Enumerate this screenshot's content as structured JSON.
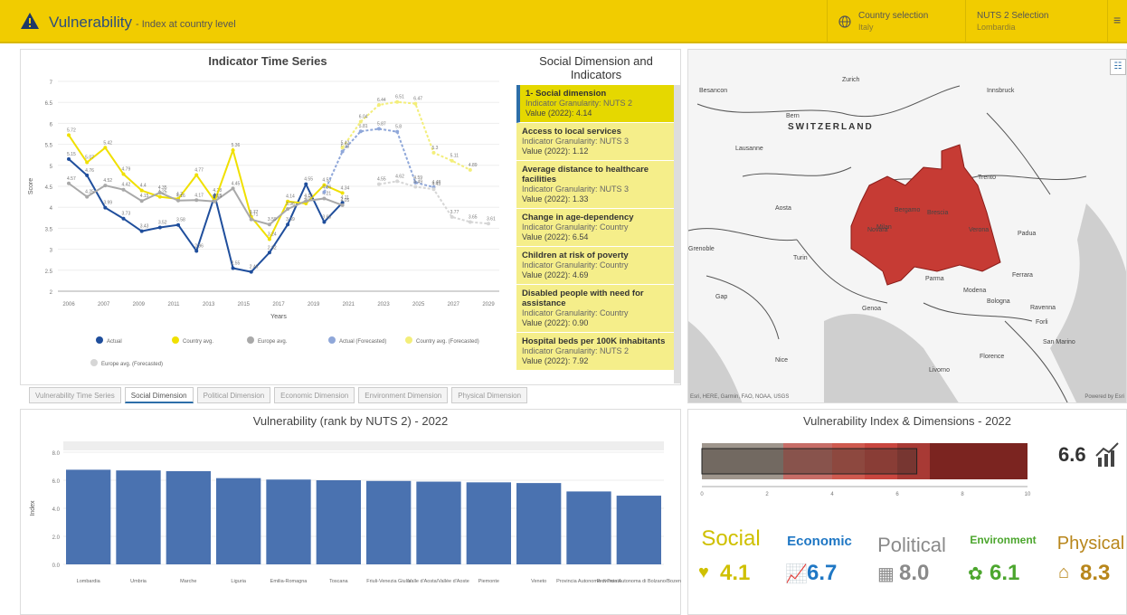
{
  "header": {
    "title": "Vulnerability",
    "subtitle": "- Index at country level",
    "country_label": "Country selection",
    "country_value": "Italy",
    "nuts_label": "NUTS 2 Selection",
    "nuts_value": "Lombardia"
  },
  "timeseries": {
    "title": "Indicator Time Series",
    "ylabel": "Score",
    "xlabel": "Years",
    "legend": [
      "Actual",
      "Country avg.",
      "Europe avg.",
      "Actual (Forecasted)",
      "Country avg. (Forecasted)",
      "Europe avg. (Forecasted)"
    ],
    "colors": {
      "actual": "#1f4e9c",
      "country": "#f0e000",
      "europe": "#a9a9a9",
      "actual_f": "#8fa7d9",
      "country_f": "#f3ee7a",
      "europe_f": "#d6d6d6"
    }
  },
  "chart_data": [
    {
      "type": "line",
      "title": "Indicator Time Series",
      "xlabel": "Years",
      "ylabel": "Score",
      "ylim": [
        2,
        7
      ],
      "x_ticks": [
        "2006",
        "2007",
        "2009",
        "2011",
        "2013",
        "2015",
        "2017",
        "2019",
        "2021",
        "2023",
        "2025",
        "2027",
        "2029"
      ],
      "y_ticks": [
        "2",
        "2.5",
        "3",
        "3.5",
        "4",
        "4.5",
        "5",
        "5.5",
        "6",
        "6.5",
        "7"
      ],
      "series": [
        {
          "name": "Actual",
          "values": [
            5.15,
            4.76,
            3.99,
            3.73,
            3.43,
            3.52,
            3.58,
            2.96,
            4.28,
            2.55,
            2.46,
            2.92,
            3.59,
            4.55,
            3.65,
            4.11
          ]
        },
        {
          "name": "Country avg.",
          "values": [
            5.72,
            5.07,
            5.42,
            4.79,
            4.4,
            4.25,
            4.2,
            4.77,
            4.15,
            5.36,
            3.77,
            3.24,
            4.14,
            4.09,
            4.53,
            4.34
          ]
        },
        {
          "name": "Europe avg.",
          "values": [
            4.57,
            4.25,
            4.52,
            4.42,
            4.15,
            4.35,
            4.16,
            4.17,
            4.14,
            4.45,
            3.71,
            3.59,
            3.96,
            4.15,
            4.21,
            4.05
          ]
        },
        {
          "name": "Actual (Forecasted)",
          "values": [
            4.36,
            5.33,
            5.81,
            5.87,
            5.8,
            4.59,
            4.48
          ]
        },
        {
          "name": "Country avg. (Forecasted)",
          "values": [
            5.42,
            6.04,
            6.44,
            6.51,
            6.47,
            5.3,
            5.11,
            4.89
          ]
        },
        {
          "name": "Europe avg. (Forecasted)",
          "values": [
            4.55,
            4.62,
            4.49,
            4.43,
            3.77,
            3.65,
            3.61
          ]
        }
      ],
      "labels_actual": [
        "5.15",
        "4.76",
        "3.99",
        "3.73",
        "3.43",
        "3.52",
        "3.58",
        "2.96",
        "4.28",
        "2.55",
        "2.46",
        "2.92",
        "3.59",
        "4.55",
        "3.65",
        "4.11"
      ],
      "labels_country": [
        "5.72",
        "5.07",
        "5.42",
        "4.79",
        "4.4",
        "4.25",
        "4.2",
        "4.77",
        "4.15",
        "5.36",
        "3.77",
        "3.24",
        "4.14",
        "4.09",
        "4.53",
        "4.34"
      ],
      "labels_europe": [
        "4.57",
        "4.25",
        "4.52",
        "4.42",
        "4.15",
        "4.35",
        "4.16",
        "4.17",
        "4.14",
        "4.45",
        "3.71",
        "3.59",
        "3.96",
        "4.15",
        "4.21",
        "4.05"
      ],
      "labels_actual_f": [
        "4.36",
        "5.33",
        "5.81",
        "5.87",
        "5.8",
        "4.59",
        "4.48"
      ],
      "labels_country_f": [
        "5.42",
        "6.04",
        "6.44",
        "6.51",
        "6.47",
        "5.3",
        "5.11",
        "4.89"
      ],
      "labels_europe_f": [
        "4.55",
        "4.62",
        "4.49",
        "4.43",
        "3.77",
        "3.65",
        "3.61"
      ]
    },
    {
      "type": "bar",
      "title": "Vulnerability (rank by NUTS 2) - 2022",
      "xlabel": "",
      "ylabel": "Index",
      "ylim": [
        0,
        8
      ],
      "y_ticks": [
        "0.0",
        "2.0",
        "4.0",
        "6.0",
        "8.0"
      ],
      "categories": [
        "Lombardia",
        "Umbria",
        "Marche",
        "Liguria",
        "Emilia-Romagna",
        "Toscana",
        "Friuli-Venezia Giulia",
        "Valle d'Aosta/Vallée d'Aoste",
        "Piemonte",
        "Veneto",
        "Provincia Autonoma di Trento",
        "Provincia Autonoma di Bolzano/Bozen"
      ],
      "values": [
        6.75,
        6.7,
        6.65,
        6.15,
        6.05,
        6.0,
        5.95,
        5.9,
        5.85,
        5.8,
        5.2,
        4.9
      ]
    },
    {
      "type": "bar",
      "title": "Vulnerability Index & Dimensions - 2022",
      "x_ticks": [
        "0",
        "2",
        "4",
        "6",
        "8",
        "10"
      ],
      "xlim": [
        0,
        10
      ],
      "value": 6.6
    }
  ],
  "social": {
    "title": "Social Dimension and Indicators",
    "items": [
      {
        "name": "1- Social dimension",
        "gran": "Indicator Granularity: NUTS 2",
        "val": "Value (2022): 4.14"
      },
      {
        "name": "Access to local services",
        "gran": "Indicator Granularity: NUTS 3",
        "val": "Value (2022): 1.12"
      },
      {
        "name": "Average distance to healthcare facilities",
        "gran": "Indicator Granularity: NUTS 3",
        "val": "Value (2022): 1.33"
      },
      {
        "name": "Change in age-dependency",
        "gran": "Indicator Granularity: Country",
        "val": "Value (2022): 6.54"
      },
      {
        "name": "Children at risk of poverty",
        "gran": "Indicator Granularity: Country",
        "val": "Value (2022): 4.69"
      },
      {
        "name": "Disabled people with need for assistance",
        "gran": "Indicator Granularity: Country",
        "val": "Value (2022): 0.90"
      },
      {
        "name": "Hospital beds per 100K inhabitants",
        "gran": "Indicator Granularity: NUTS 2",
        "val": "Value (2022): 7.92"
      }
    ]
  },
  "tabs": [
    "Vulnerability Time Series",
    "Social Dimension",
    "Political Dimension",
    "Economic Dimension",
    "Environment Dimension",
    "Physical Dimension"
  ],
  "map": {
    "country": "SWITZERLAND",
    "cities": [
      "Besancon",
      "Zurich",
      "Innsbruck",
      "Bern",
      "Lausanne",
      "Bergamo",
      "Brescia",
      "Trento",
      "Aosta",
      "Novara",
      "Milan",
      "Verona",
      "Padua",
      "Grenoble",
      "Turin",
      "Parma",
      "Ferrara",
      "Modena",
      "Bologna",
      "Gap",
      "Genoa",
      "Ravenna",
      "Forli",
      "Nice",
      "Florence",
      "San Marino",
      "Livorno"
    ],
    "attribution": "Esri, HERE, Garmin, FAO, NOAA, USGS",
    "powered": "Powered by Esri"
  },
  "dims": {
    "title": "Vulnerability Index & Dimensions - 2022",
    "index": "6.6",
    "items": [
      {
        "label": "Social",
        "value": "4.1",
        "color": "#cfc000"
      },
      {
        "label": "Economic",
        "value": "6.7",
        "color": "#1f77c4"
      },
      {
        "label": "Political",
        "value": "8.0",
        "color": "#8a8a8a"
      },
      {
        "label": "Environment",
        "value": "6.1",
        "color": "#4ca62e"
      },
      {
        "label": "Physical",
        "value": "8.3",
        "color": "#b8861b"
      }
    ]
  }
}
